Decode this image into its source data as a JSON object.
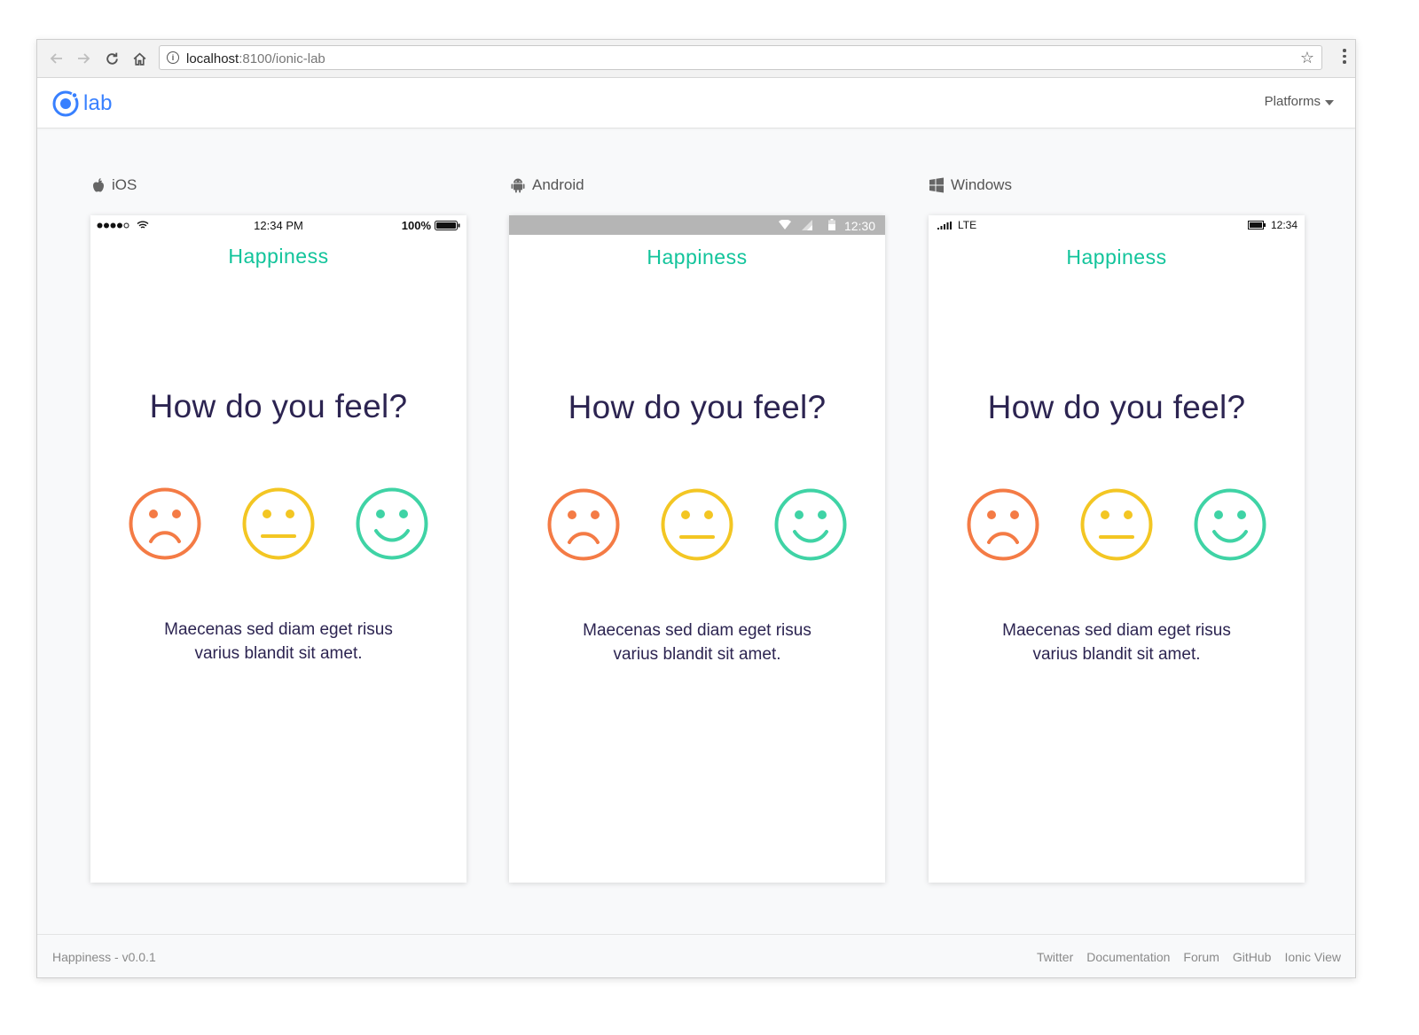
{
  "browser": {
    "url_host": "localhost",
    "url_rest": ":8100/ionic-lab",
    "icons": [
      "back-arrow-icon",
      "forward-arrow-icon",
      "reload-icon",
      "home-icon",
      "info-icon",
      "star-icon",
      "kebab-menu-icon"
    ]
  },
  "lab": {
    "logo_text": "lab",
    "platforms_label": "Platforms",
    "accent": "#3880ff"
  },
  "platforms": [
    {
      "label": "iOS",
      "icon": "apple-icon",
      "status": {
        "time": "12:34 PM",
        "battery": "100%"
      }
    },
    {
      "label": "Android",
      "icon": "android-icon",
      "status": {
        "time": "12:30"
      }
    },
    {
      "label": "Windows",
      "icon": "windows-icon",
      "status": {
        "network": "LTE",
        "time": "12:34"
      }
    }
  ],
  "app": {
    "title": "Happiness",
    "question": "How do you feel?",
    "description_line1": "Maecenas sed diam eget risus",
    "description_line2": "varius blandit sit amet.",
    "title_color": "#12c49b",
    "text_color": "#2c2451",
    "faces": [
      {
        "icon": "sad-face-icon",
        "color": "#f47b45"
      },
      {
        "icon": "neutral-face-icon",
        "color": "#f3c623"
      },
      {
        "icon": "happy-face-icon",
        "color": "#3fd3a5"
      }
    ]
  },
  "footer": {
    "version": "Happiness - v0.0.1",
    "links": [
      "Twitter",
      "Documentation",
      "Forum",
      "GitHub",
      "Ionic View"
    ]
  }
}
